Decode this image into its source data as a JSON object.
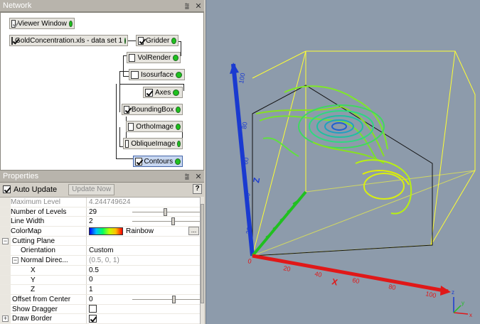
{
  "network": {
    "title": "Network",
    "pin_glyph": "⩰",
    "close_glyph": "✕",
    "nodes": [
      {
        "label": "Viewer Window",
        "checked": true
      },
      {
        "label": "GoldConcentration.xls - data set 1",
        "checked": true
      },
      {
        "label": "Gridder",
        "checked": true
      },
      {
        "label": "VolRender",
        "checked": false
      },
      {
        "label": "Isosurface",
        "checked": false
      },
      {
        "label": "Axes",
        "checked": true
      },
      {
        "label": "BoundingBox",
        "checked": true
      },
      {
        "label": "OrthoImage",
        "checked": false
      },
      {
        "label": "ObliqueImage",
        "checked": false
      },
      {
        "label": "Contours",
        "checked": true
      }
    ]
  },
  "properties": {
    "title": "Properties",
    "auto_update_label": "Auto Update",
    "update_now_label": "Update Now",
    "help_label": "?",
    "rows": [
      {
        "label": "Maximum Level",
        "value": "4.244749624"
      },
      {
        "label": "Number of Levels",
        "value": "29",
        "slider": 0.48
      },
      {
        "label": "Line Width",
        "value": "2",
        "slider": 0.6
      },
      {
        "label": "ColorMap",
        "value": "Rainbow",
        "button": "..."
      },
      {
        "label": "Cutting Plane",
        "value": "",
        "expander": "−"
      },
      {
        "label": "Orientation",
        "value": "Custom"
      },
      {
        "label": "Normal Direc...",
        "value": "(0.5, 0, 1)",
        "expander": "−"
      },
      {
        "label": "X",
        "value": "0.5"
      },
      {
        "label": "Y",
        "value": "0"
      },
      {
        "label": "Z",
        "value": "1"
      },
      {
        "label": "Offset from Center",
        "value": "0",
        "slider": 0.62
      },
      {
        "label": "Show Dragger",
        "value": ""
      },
      {
        "label": "Draw Border",
        "value": "",
        "expander": "+"
      }
    ]
  },
  "viewer": {
    "background": "#8d9bab",
    "z_axis": {
      "label": "Z",
      "ticks": [
        "100",
        "80",
        "60",
        "40",
        "20",
        "0"
      ],
      "color": "#1a3ad0"
    },
    "x_axis": {
      "label": "X",
      "ticks": [
        "0",
        "20",
        "40",
        "60",
        "80",
        "100"
      ],
      "color": "#e01818"
    },
    "y_axis": {
      "color": "#20c020"
    },
    "bbox_color": "#ffff33",
    "triad": {
      "x": "x",
      "y": "y",
      "z": "z"
    }
  }
}
